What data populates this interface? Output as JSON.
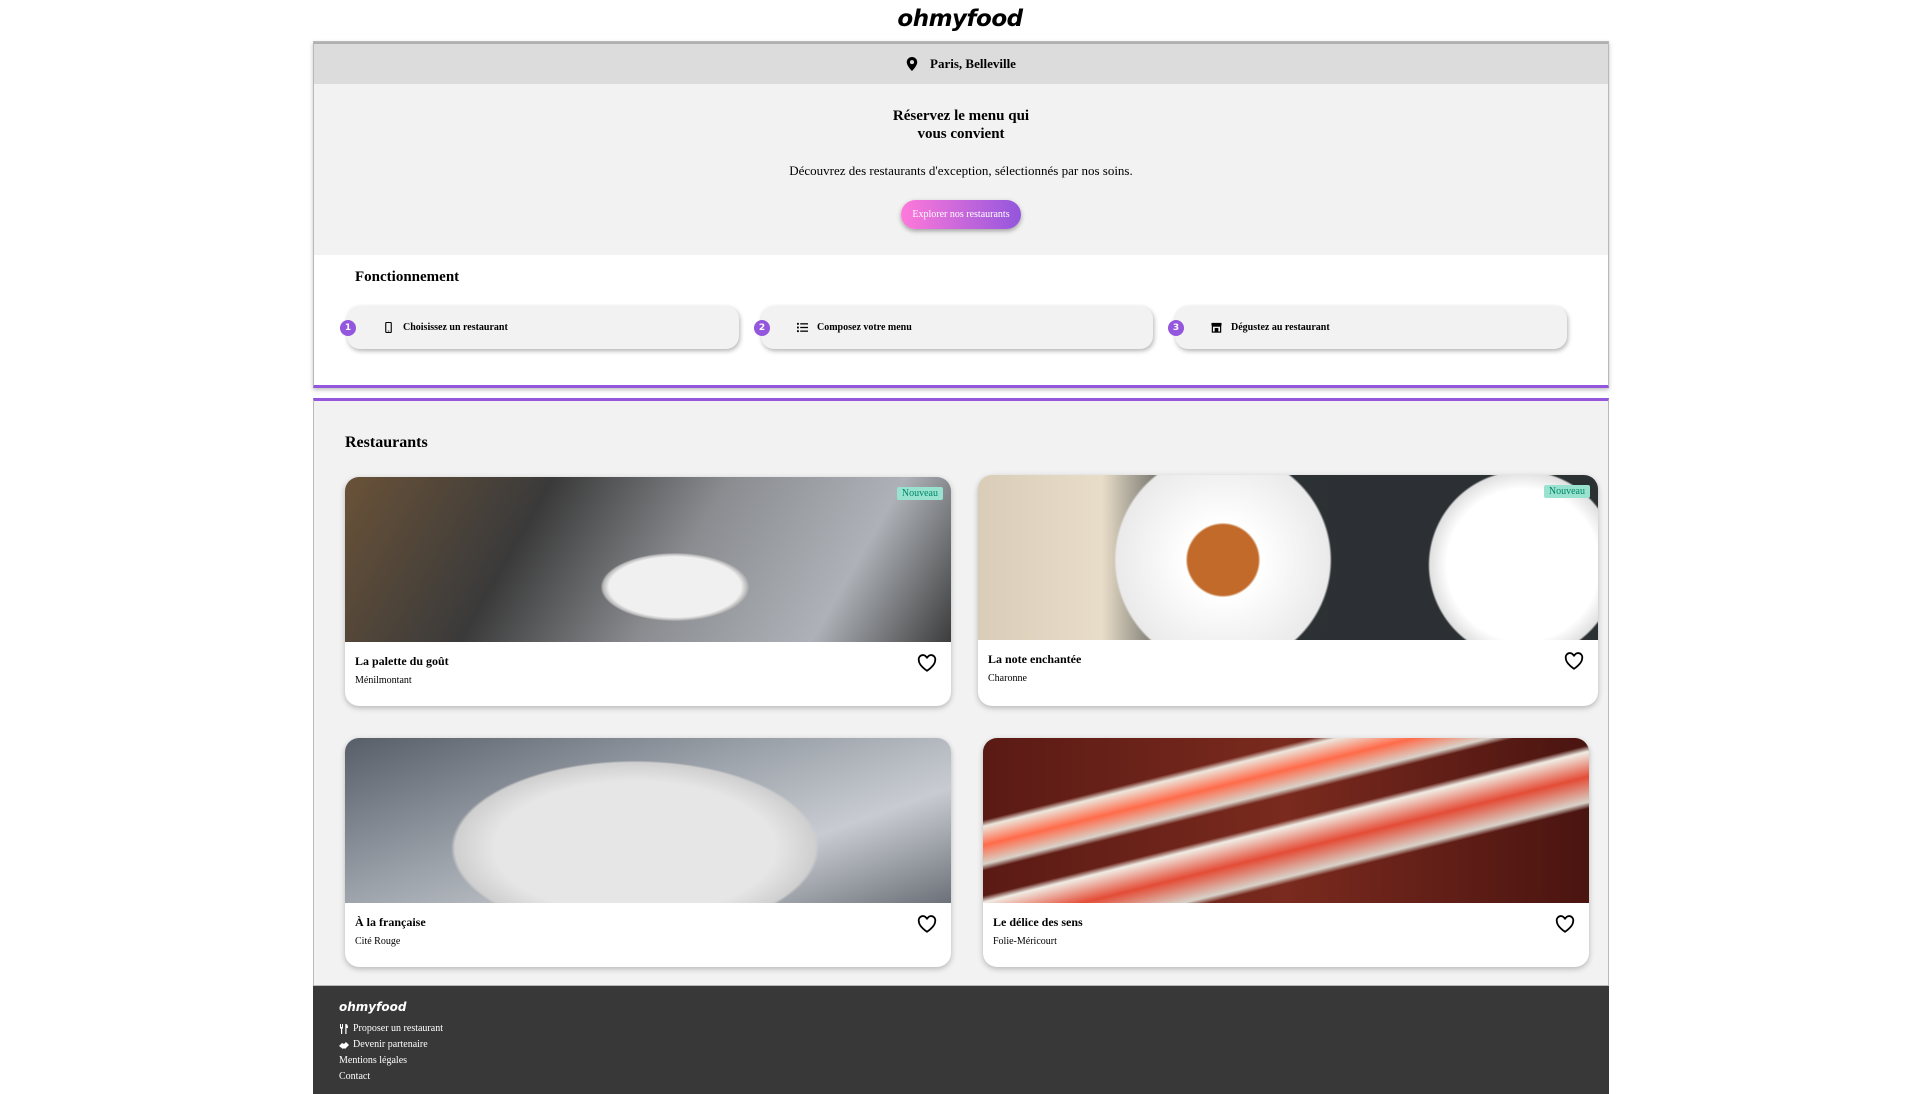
{
  "brand": {
    "logo": "ohmyfood"
  },
  "location": {
    "label": "Paris, Belleville",
    "icon": "map-pin-icon"
  },
  "hero": {
    "title": "Réservez le menu qui\nvous convient",
    "subtitle": "Découvrez des restaurants d'exception, sélectionnés par nos soins.",
    "cta": "Explorer nos restaurants"
  },
  "how": {
    "title": "Fonctionnement",
    "steps": [
      {
        "num": "1",
        "label": "Choisissez un restaurant",
        "icon": "mobile-phone-icon"
      },
      {
        "num": "2",
        "label": "Composez votre menu",
        "icon": "list-icon"
      },
      {
        "num": "3",
        "label": "Dégustez au restaurant",
        "icon": "store-icon"
      }
    ]
  },
  "restaurants": {
    "title": "Restaurants",
    "items": [
      {
        "name": "La palette du goût",
        "area": "Ménilmontant",
        "badge": "Nouveau"
      },
      {
        "name": "La note enchantée",
        "area": "Charonne",
        "badge": "Nouveau"
      },
      {
        "name": "À la française",
        "area": "Cité Rouge"
      },
      {
        "name": "Le délice des sens",
        "area": "Folie-Méricourt"
      }
    ]
  },
  "footer": {
    "logo": "ohmyfood",
    "links": [
      {
        "label": "Proposer un restaurant",
        "icon": "utensils-icon"
      },
      {
        "label": "Devenir partenaire",
        "icon": "handshake-icon"
      },
      {
        "label": "Mentions légales"
      },
      {
        "label": "Contact"
      }
    ]
  },
  "colors": {
    "accent": "#9356dc",
    "gradient_start": "#ff79da",
    "badge_bg": "#99e2d0",
    "badge_text": "#008766",
    "footer_bg": "#383838"
  }
}
